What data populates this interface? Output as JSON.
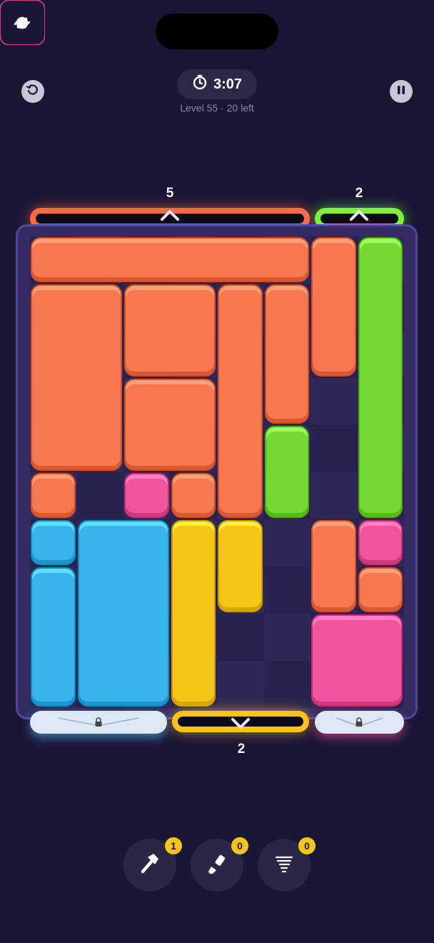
{
  "header": {
    "timer": "3:07",
    "level": "Level 55 · 20 left",
    "restart_icon": "restart-icon",
    "pause_icon": "pause-icon",
    "timer_icon": "stopwatch-icon"
  },
  "exits": {
    "top_red": {
      "count": "5",
      "color": "#ff6a45",
      "direction": "up"
    },
    "top_green": {
      "count": "2",
      "color": "#7cf33a",
      "direction": "up"
    },
    "bottom_yellow": {
      "count": "2",
      "color": "#ffc21a",
      "direction": "down"
    },
    "bottom_blue": {
      "locked": true,
      "color": "#5ac8ff"
    },
    "bottom_pink": {
      "locked": true,
      "color": "#ff4fa6"
    }
  },
  "colors": {
    "orange": "#f8774e",
    "green": "#74d936",
    "pink": "#f0559b",
    "blue": "#38b4ea",
    "yellow": "#f5c518"
  },
  "tools": [
    {
      "icon": "hammer-icon",
      "count": "1"
    },
    {
      "icon": "brush-icon",
      "count": "0"
    },
    {
      "icon": "tornado-icon",
      "count": "0"
    }
  ]
}
